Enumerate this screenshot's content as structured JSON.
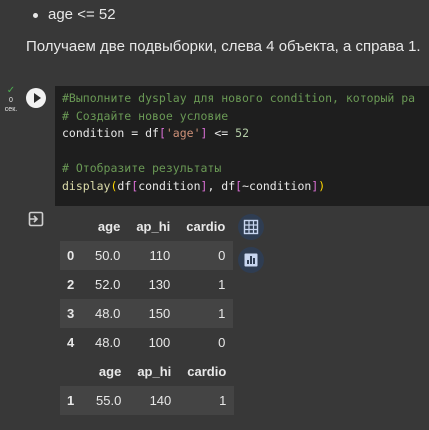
{
  "markdown": {
    "bullet": "age <= 52",
    "paragraph": "Получаем две подвыборки, слева 4 объекта, а справа 1."
  },
  "cell": {
    "exec_count": "0",
    "exec_unit": "сек.",
    "code_lines": [
      "#Выполните dysplay для нового condition, который ра",
      "# Создайте новое условие",
      "condition = df['age'] <= 52",
      "",
      "# Отобразите результаты",
      "display(df[condition], df[~condition])"
    ]
  },
  "output": {
    "table1": {
      "columns": [
        "",
        "age",
        "ap_hi",
        "cardio"
      ],
      "rows": [
        [
          "0",
          "50.0",
          "110",
          "0"
        ],
        [
          "2",
          "52.0",
          "130",
          "1"
        ],
        [
          "3",
          "48.0",
          "150",
          "1"
        ],
        [
          "4",
          "48.0",
          "100",
          "0"
        ]
      ]
    },
    "table2": {
      "columns": [
        "",
        "age",
        "ap_hi",
        "cardio"
      ],
      "rows": [
        [
          "1",
          "55.0",
          "140",
          "1"
        ]
      ]
    },
    "icons": {
      "output_icon": "output-redirect-icon",
      "table_button": "table-view-icon",
      "chart_button": "chart-suggest-icon"
    }
  }
}
